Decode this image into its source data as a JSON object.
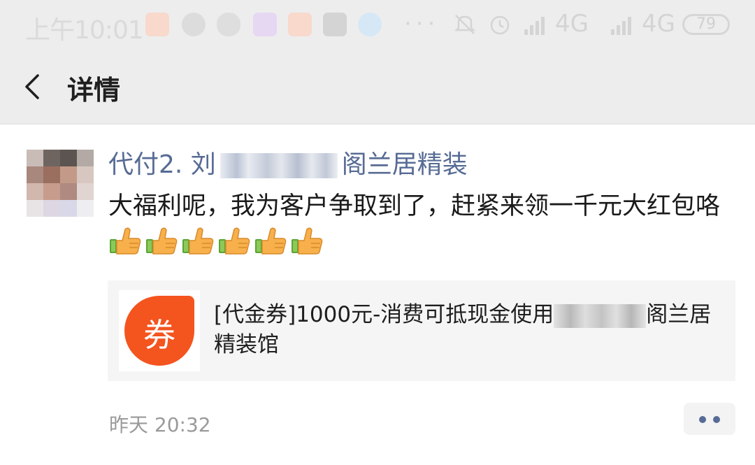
{
  "status_bar": {
    "time": "上午10:01",
    "dots": "···",
    "signal_1": "4G",
    "signal_2": "4G",
    "battery": "79"
  },
  "nav": {
    "title": "详情"
  },
  "post": {
    "sender_prefix": "代付2. 刘",
    "sender_suffix": "阁兰居精装",
    "message": "大福利呢，我为客户争取到了，赶紧来领一千元大红包咯",
    "emoji_name": "thumbs-up",
    "emoji_count": 6,
    "card": {
      "icon_char": "券",
      "title_prefix": "[代金券]1000元-消费可抵现金使用",
      "title_suffix": "阁兰居精装馆"
    },
    "timestamp": "昨天 20:32"
  },
  "colors": {
    "link": "#576b95",
    "coupon": "#f4541e",
    "navbar_bg": "#ededed"
  }
}
